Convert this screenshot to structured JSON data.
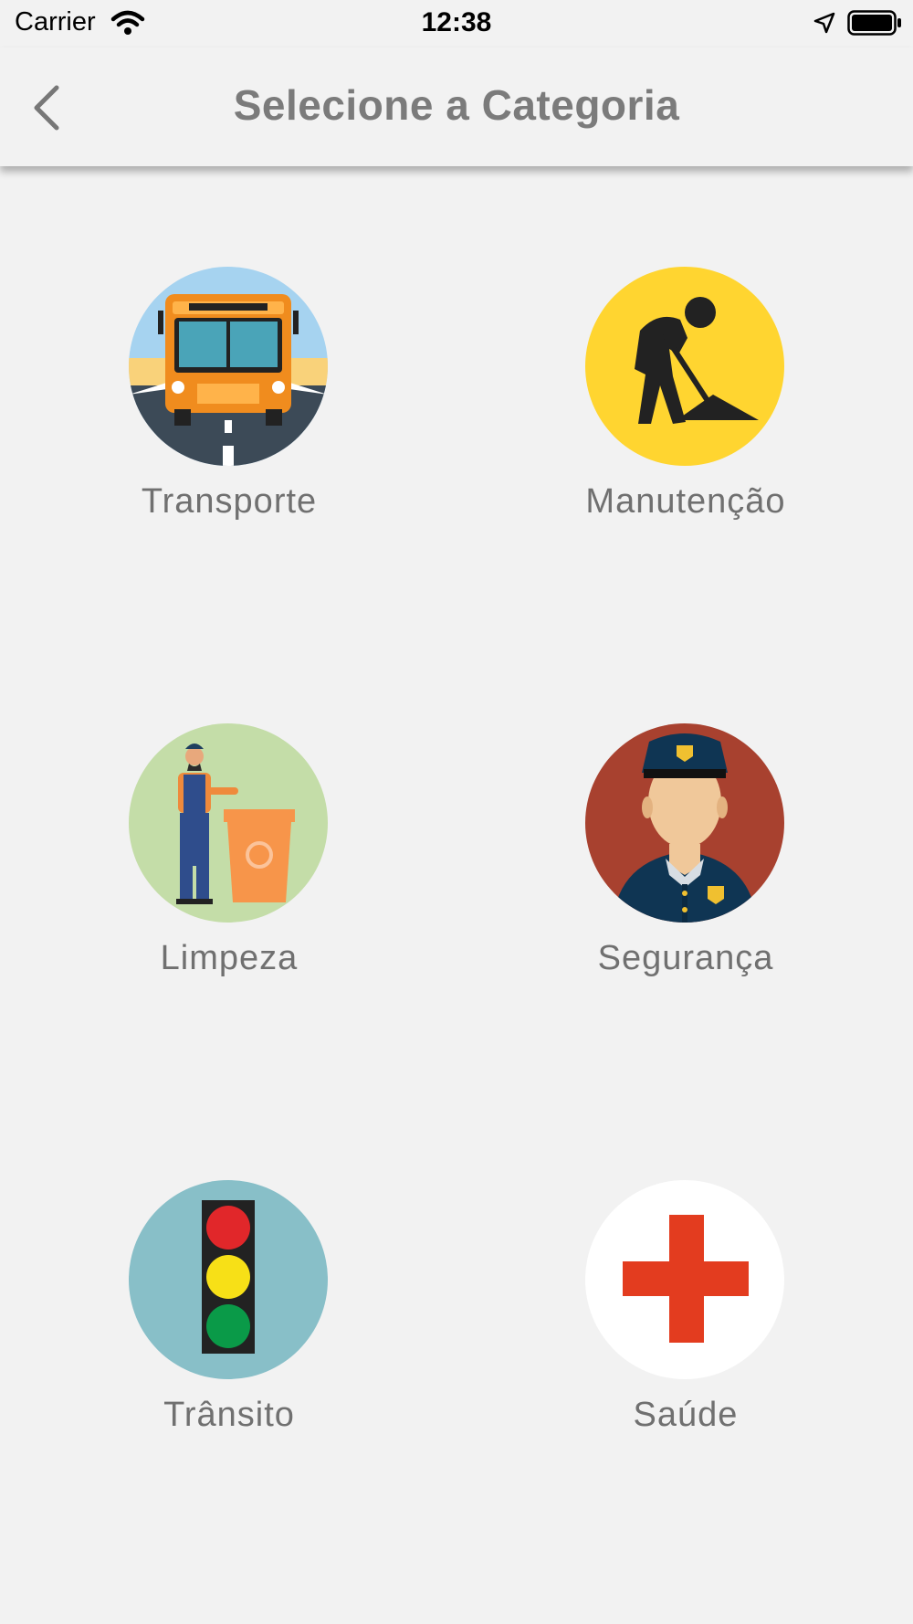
{
  "status_bar": {
    "carrier": "Carrier",
    "time": "12:38",
    "icons": [
      "wifi-icon",
      "location-arrow-icon",
      "battery-icon"
    ]
  },
  "header": {
    "title": "Selecione a Categoria",
    "back_icon": "chevron-left-icon"
  },
  "categories": [
    {
      "label": "Transporte",
      "icon": "bus-icon"
    },
    {
      "label": "Manutenção",
      "icon": "worker-shovel-icon"
    },
    {
      "label": "Limpeza",
      "icon": "cleaner-trash-bin-icon"
    },
    {
      "label": "Segurança",
      "icon": "police-officer-icon"
    },
    {
      "label": "Trânsito",
      "icon": "traffic-light-icon"
    },
    {
      "label": "Saúde",
      "icon": "red-cross-icon"
    }
  ],
  "colors": {
    "background": "#f2f2f2",
    "title": "#7b7b7b",
    "label": "#707070",
    "manutencao": "#ffd530",
    "limpeza": "#c4dda8",
    "seguranca": "#a8412f",
    "transito": "#88bfc8",
    "saude_cross": "#e33c1f"
  }
}
